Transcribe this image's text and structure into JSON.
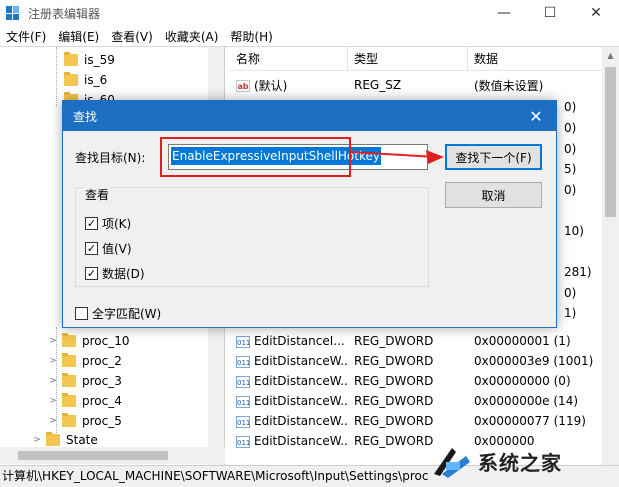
{
  "window": {
    "title": "注册表编辑器",
    "controls": {
      "minimize": "—",
      "maximize": "☐",
      "close": "✕"
    }
  },
  "menu": [
    "文件(F)",
    "编辑(E)",
    "查看(V)",
    "收藏夹(A)",
    "帮助(H)"
  ],
  "tree": {
    "top_items": [
      "is_59",
      "is_6",
      "is_60"
    ],
    "bottom_items": [
      "proc_10",
      "proc_2",
      "proc_3",
      "proc_4",
      "proc_5"
    ],
    "state_item": "State"
  },
  "list": {
    "columns": [
      "名称",
      "类型",
      "数据"
    ],
    "rows": [
      {
        "icon": "ab",
        "name": "(默认)",
        "type": "REG_SZ",
        "data": "(数值未设置)"
      },
      {
        "icon": "bin",
        "name": "EditDistanceI...",
        "type": "REG_DWORD",
        "data": "0x00000001 (1)"
      },
      {
        "icon": "bin",
        "name": "EditDistanceW...",
        "type": "REG_DWORD",
        "data": "0x000003e9 (1001)"
      },
      {
        "icon": "bin",
        "name": "EditDistanceW...",
        "type": "REG_DWORD",
        "data": "0x00000000 (0)"
      },
      {
        "icon": "bin",
        "name": "EditDistanceW...",
        "type": "REG_DWORD",
        "data": "0x0000000e (14)"
      },
      {
        "icon": "bin",
        "name": "EditDistanceW...",
        "type": "REG_DWORD",
        "data": "0x00000077 (119)"
      },
      {
        "icon": "bin",
        "name": "EditDistanceW...",
        "type": "REG_DWORD",
        "data": "0x000000"
      }
    ],
    "partial_data_right": [
      "0)",
      "0)",
      "0)",
      "5)",
      "0)",
      "10)",
      "281)",
      "0)",
      "1)"
    ]
  },
  "status": "计算机\\HKEY_LOCAL_MACHINE\\SOFTWARE\\Microsoft\\Input\\Settings\\proc",
  "dialog": {
    "title": "查找",
    "close": "✕",
    "find_label": "查找目标(N):",
    "find_value": "EnableExpressiveInputShellHotkey",
    "find_next": "查找下一个(F)",
    "cancel": "取消",
    "look_group": "查看",
    "options": [
      {
        "label": "项(K)",
        "checked": true
      },
      {
        "label": "值(V)",
        "checked": true
      },
      {
        "label": "数据(D)",
        "checked": true
      }
    ],
    "whole_match": {
      "label": "全字匹配(W)",
      "checked": false
    }
  },
  "watermark": {
    "text": "系统之家"
  },
  "colors": {
    "accent": "#1c6fc2",
    "annotation": "#e02020",
    "selection": "#0078d7"
  }
}
